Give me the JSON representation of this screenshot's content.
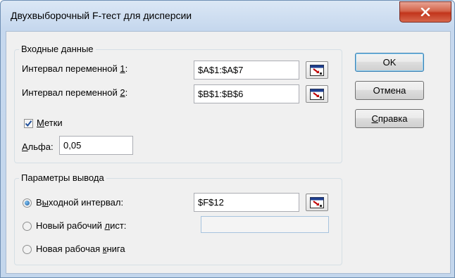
{
  "dialog": {
    "title": "Двухвыборочный F-тест для дисперсии"
  },
  "input": {
    "group_title": "Входные данные",
    "var1": {
      "label_pre": "Интервал переменной ",
      "label_key": "1",
      "label_post": ":",
      "value": "$A$1:$A$7"
    },
    "var2": {
      "label_pre": "Интервал переменной ",
      "label_key": "2",
      "label_post": ":",
      "value": "$B$1:$B$6"
    },
    "labels": {
      "key": "М",
      "rest": "етки",
      "checked": true
    },
    "alpha": {
      "key": "А",
      "rest": "льфа:",
      "value": "0,05"
    }
  },
  "output": {
    "group_title": "Параметры вывода",
    "range": {
      "pre": "В",
      "key": "ы",
      "post": "ходной интервал:",
      "value": "$F$12",
      "selected": true
    },
    "new_sheet": {
      "pre": "Новый рабочий ",
      "key": "л",
      "post": "ист:",
      "value": "",
      "selected": false
    },
    "new_book": {
      "pre": "Новая рабочая ",
      "key": "к",
      "post": "нига",
      "selected": false
    }
  },
  "buttons": {
    "ok": "OK",
    "cancel": "Отмена",
    "help_key": "С",
    "help_rest": "правка"
  },
  "icons": {
    "close": "close-x-icon",
    "ref": "range-select-icon",
    "check": "checkmark-icon"
  },
  "colors": {
    "close_button": "#c2351c",
    "title_bar": "#c6d8ee",
    "radio_dot": "#1f5fa3",
    "checkmark": "#1f4f9a"
  }
}
